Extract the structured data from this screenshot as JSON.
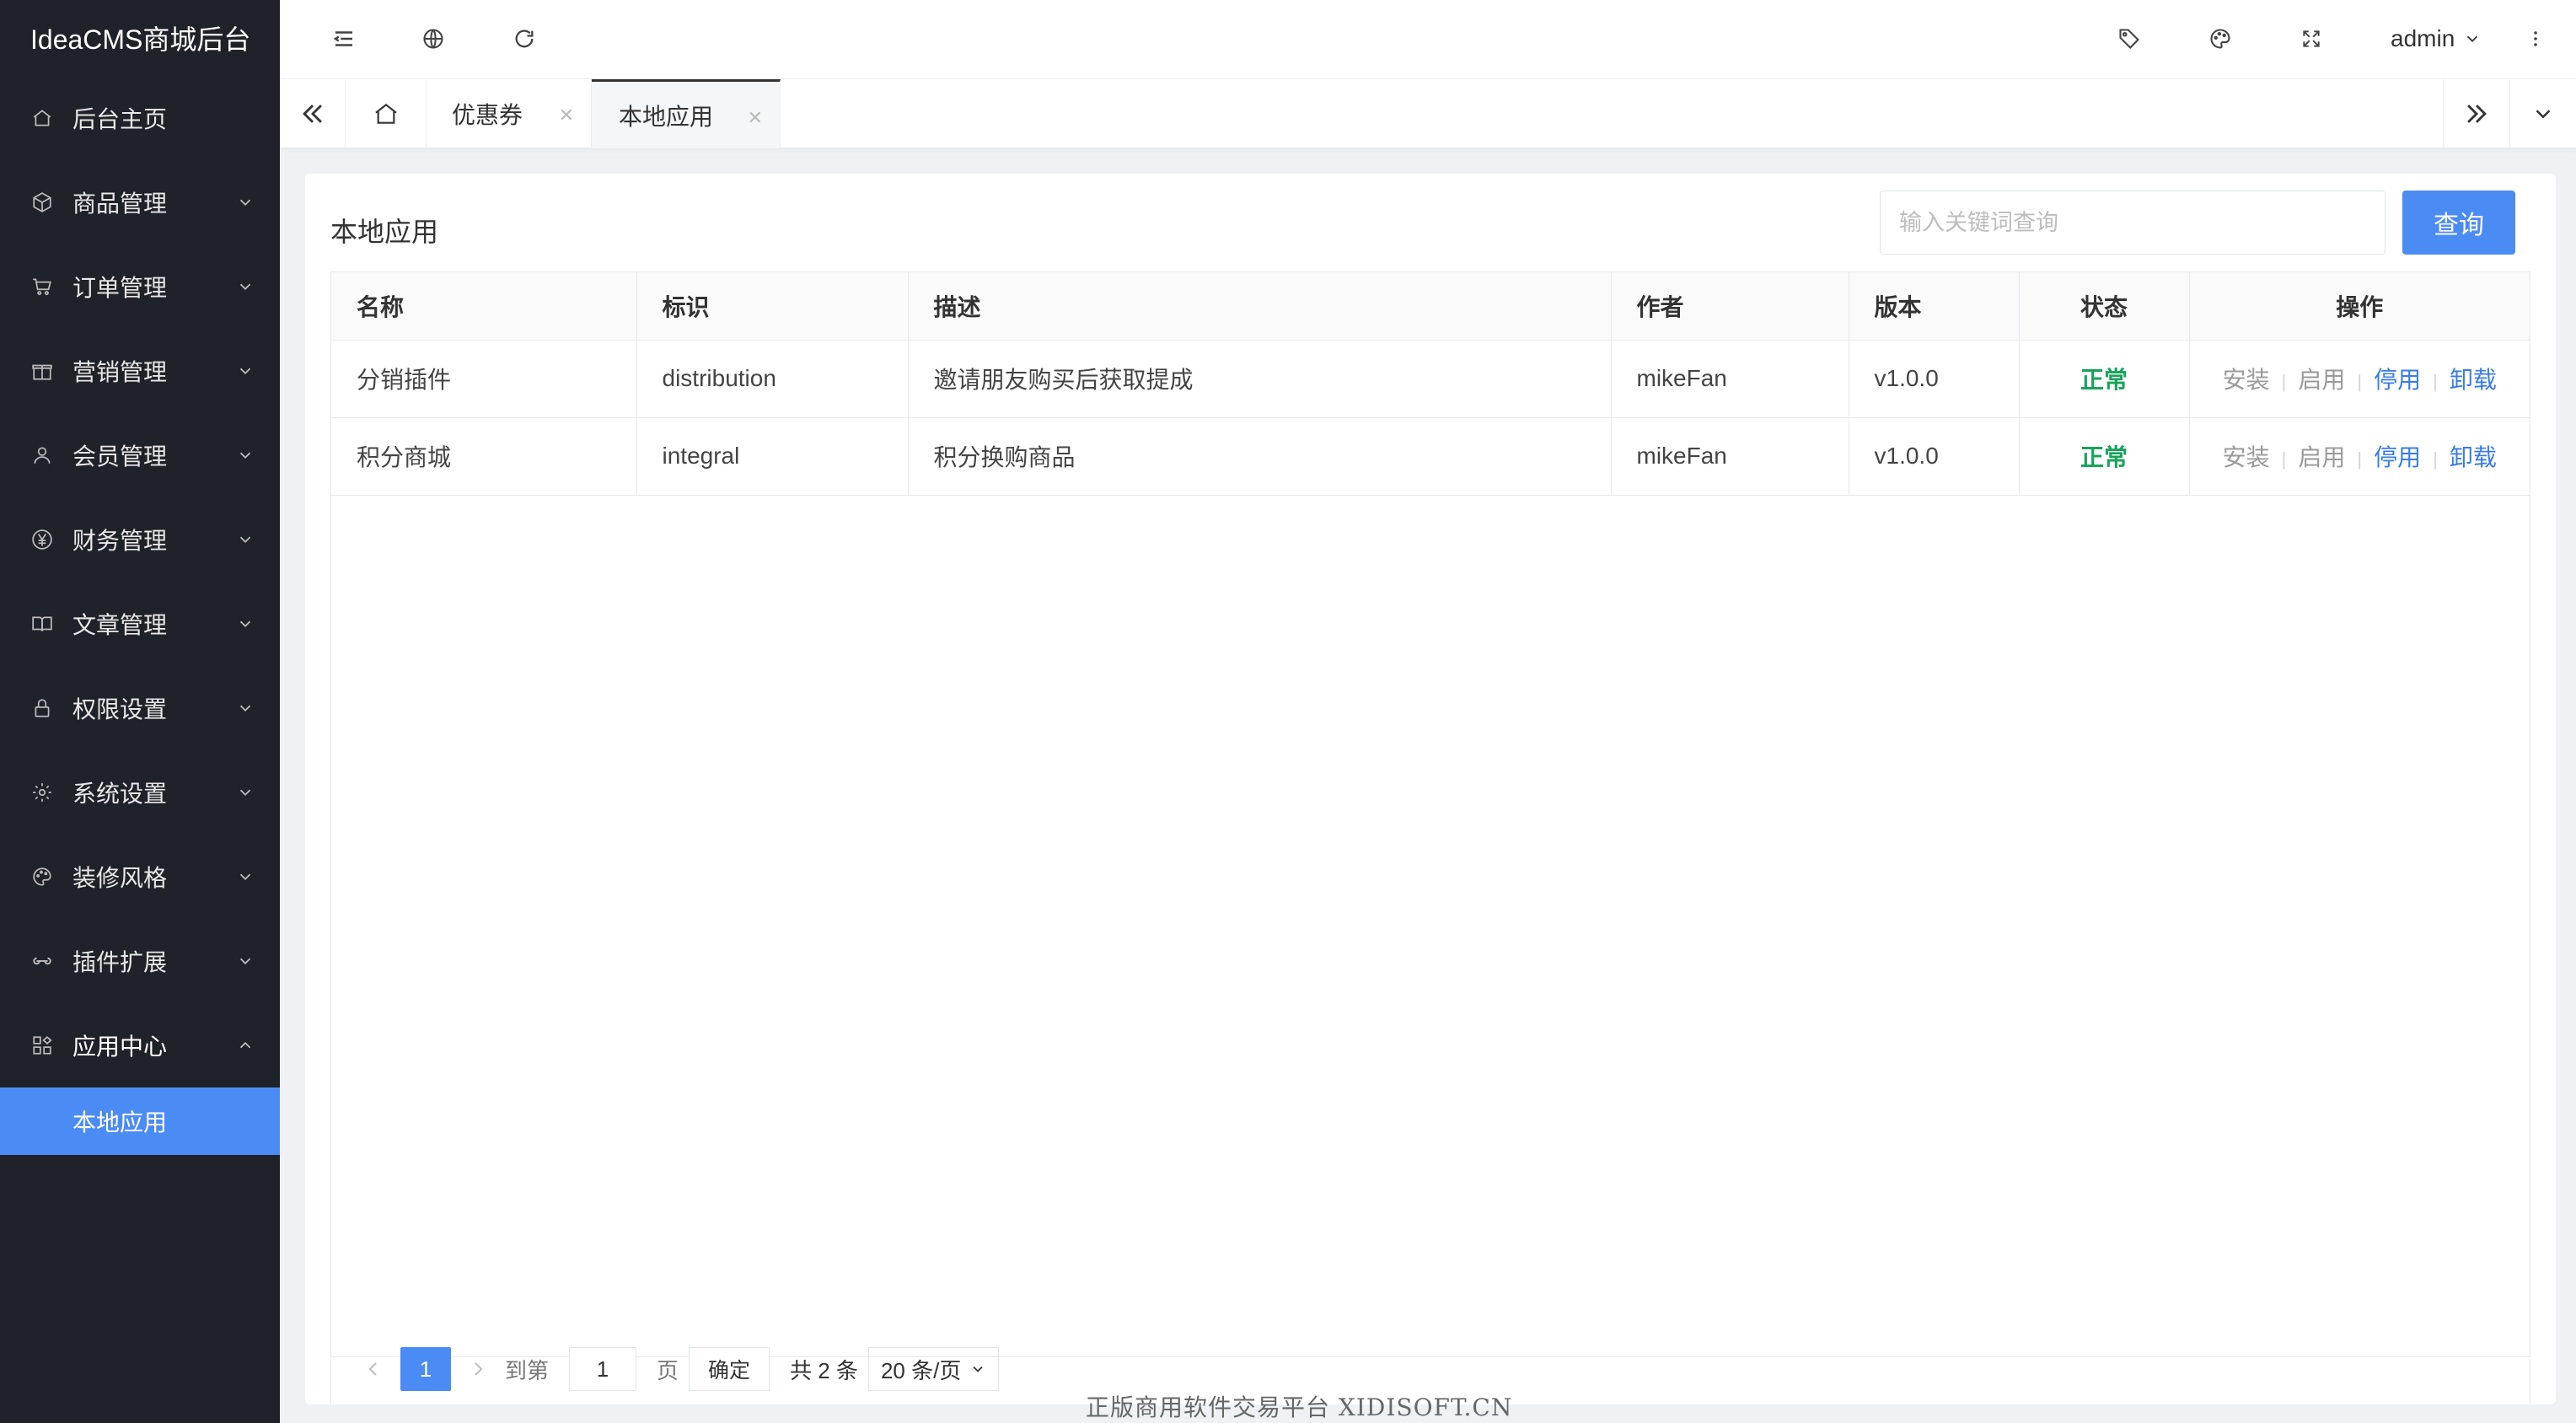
{
  "app": {
    "brand": "IdeaCMS商城后台"
  },
  "sidebar": {
    "items": [
      {
        "label": "后台主页",
        "icon": "home-icon"
      },
      {
        "label": "商品管理",
        "icon": "box-icon"
      },
      {
        "label": "订单管理",
        "icon": "cart-icon"
      },
      {
        "label": "营销管理",
        "icon": "gift-icon"
      },
      {
        "label": "会员管理",
        "icon": "user-icon"
      },
      {
        "label": "财务管理",
        "icon": "yen-icon"
      },
      {
        "label": "文章管理",
        "icon": "book-icon"
      },
      {
        "label": "权限设置",
        "icon": "lock-icon"
      },
      {
        "label": "系统设置",
        "icon": "gear-icon"
      },
      {
        "label": "装修风格",
        "icon": "palette-icon"
      },
      {
        "label": "插件扩展",
        "icon": "link-icon"
      },
      {
        "label": "应用中心",
        "icon": "apps-icon"
      }
    ],
    "active_sub": "本地应用"
  },
  "topbar": {
    "user": "admin"
  },
  "tabs": [
    {
      "label": "优惠券"
    },
    {
      "label": "本地应用"
    }
  ],
  "page": {
    "title": "本地应用",
    "search_placeholder": "输入关键词查询",
    "search_button": "查询"
  },
  "table": {
    "headers": [
      "名称",
      "标识",
      "描述",
      "作者",
      "版本",
      "状态",
      "操作"
    ],
    "rows": [
      {
        "name": "分销插件",
        "id": "distribution",
        "desc": "邀请朋友购买后获取提成",
        "author": "mikeFan",
        "version": "v1.0.0",
        "status": "正常"
      },
      {
        "name": "积分商城",
        "id": "integral",
        "desc": "积分换购商品",
        "author": "mikeFan",
        "version": "v1.0.0",
        "status": "正常"
      }
    ],
    "actions": [
      "安装",
      "启用",
      "停用",
      "卸载"
    ]
  },
  "pagination": {
    "current": "1",
    "goto_label": "到第",
    "goto_value": "1",
    "page_label": "页",
    "confirm": "确定",
    "total": "共 2 条",
    "page_size": "20 条/页"
  },
  "footer": {
    "note": "正版商用软件交易平台 XIDISOFT.CN"
  },
  "colors": {
    "sidebar_bg": "#20222a",
    "accent": "#4b8bf4",
    "status_ok": "#18a35b"
  }
}
